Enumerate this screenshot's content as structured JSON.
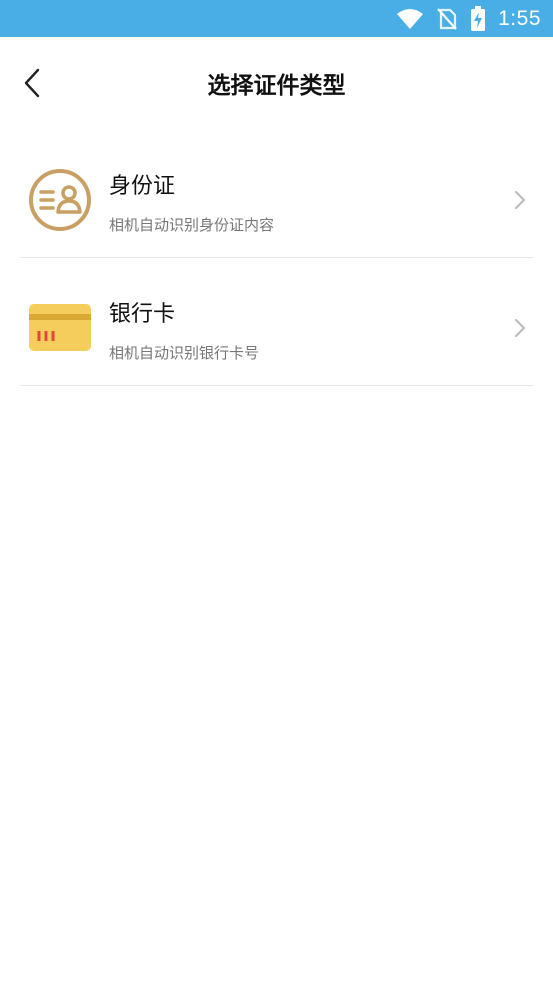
{
  "status_bar": {
    "time": "1:55",
    "icons": [
      "wifi-icon",
      "no-sim-icon",
      "battery-charging-icon"
    ],
    "background": "#49aee6"
  },
  "header": {
    "back_icon": "chevron-left-icon",
    "title": "选择证件类型"
  },
  "items": [
    {
      "icon": "id-card-icon",
      "title": "身份证",
      "subtitle": "相机自动识别身份证内容",
      "accent": "#c9a063"
    },
    {
      "icon": "bank-card-icon",
      "title": "银行卡",
      "subtitle": "相机自动识别银行卡号",
      "accent": "#f4cd5c"
    }
  ]
}
